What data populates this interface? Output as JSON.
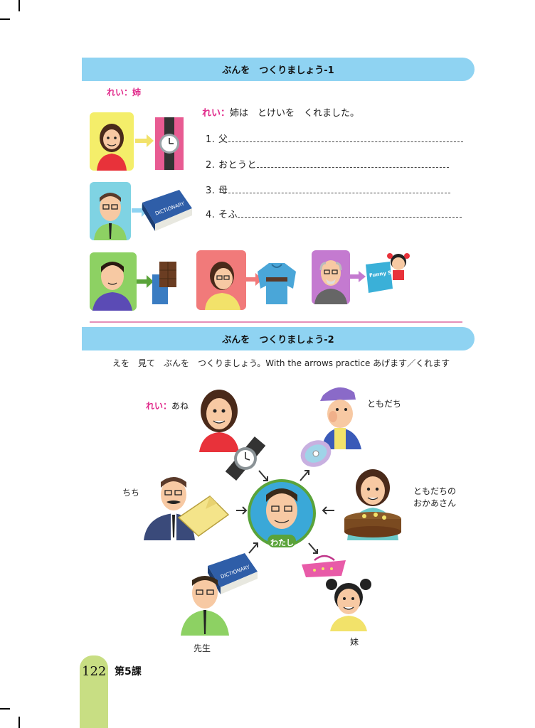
{
  "section1": {
    "title": "ぶんを　つくりましょう-1",
    "example_tag": "れい：姉",
    "example_prefix": "れい：",
    "example_sentence": "姉は　とけいを　くれました。",
    "items": [
      {
        "num": "1.",
        "word": "父"
      },
      {
        "num": "2.",
        "word": "おとうと"
      },
      {
        "num": "3.",
        "word": "母"
      },
      {
        "num": "4.",
        "word": "そふ"
      }
    ],
    "dictionary_text": "DICTIONARY",
    "book_text": "Funny Story"
  },
  "section2": {
    "title": "ぶんを　つくりましょう-2",
    "instruction": "えを　見て　ぶんを　つくりましょう。With the arrows practice あげます／くれます",
    "example_prefix": "れい：",
    "example_name": "あね",
    "labels": {
      "tomodachi": "ともだち",
      "chichi": "ちち",
      "tomodachi_mother_line1": "ともだちの",
      "tomodachi_mother_line2": "おかあさん",
      "watashi": "わたし",
      "sensei": "先生",
      "imouto": "妹"
    },
    "dictionary_text": "DICTIONARY"
  },
  "footer": {
    "page_number": "122",
    "lesson": "第5課"
  },
  "colors": {
    "header_blue": "#8fd3f2",
    "accent_pink": "#e0288a",
    "divider_pink": "#e58fb8",
    "page_tab_green": "#c8de83"
  }
}
